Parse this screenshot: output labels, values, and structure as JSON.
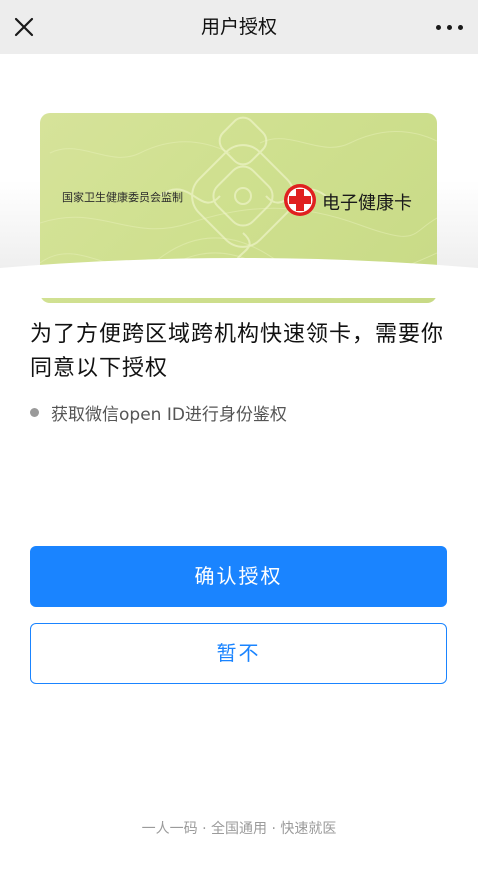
{
  "nav": {
    "title": "用户授权",
    "close_icon": "close-icon",
    "more_icon": "more-icon"
  },
  "card": {
    "issuer": "国家卫生健康委员会监制",
    "name": "电子健康卡",
    "logo_icon": "red-cross-icon",
    "colors": {
      "card_bg": "#cfe08f",
      "logo_red": "#e02020"
    }
  },
  "main": {
    "heading": "为了方便跨区域跨机构快速领卡，需要你同意以下授权",
    "permissions": [
      {
        "text": "获取微信open ID进行身份鉴权"
      }
    ]
  },
  "buttons": {
    "confirm": "确认授权",
    "decline": "暂不"
  },
  "footer": {
    "slogan": "一人一码 · 全国通用 · 快速就医"
  },
  "colors": {
    "accent": "#1a84ff",
    "nav_bg": "#ededed",
    "text_primary": "#111111",
    "text_secondary": "#555555",
    "footer_text": "#9b9b9b"
  }
}
